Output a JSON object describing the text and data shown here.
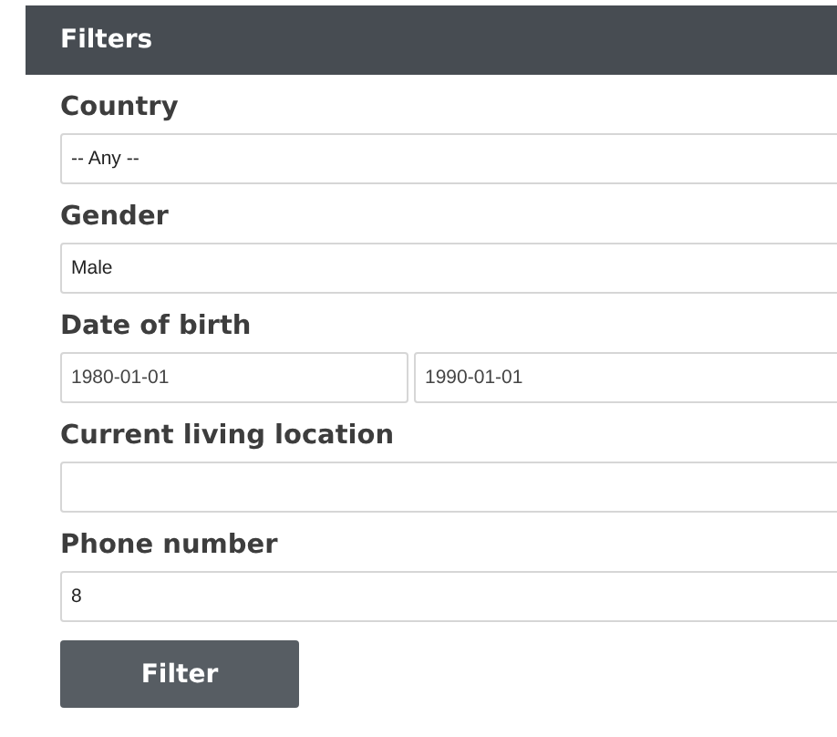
{
  "panel": {
    "title": "Filters"
  },
  "fields": [
    {
      "kind": "select",
      "label": "Country",
      "values": [
        "-- Any --"
      ]
    },
    {
      "kind": "select",
      "label": "Gender",
      "values": [
        "Male"
      ]
    },
    {
      "kind": "range",
      "label": "Date of birth",
      "values": [
        "1980-01-01",
        "1990-01-01"
      ]
    },
    {
      "kind": "text",
      "label": "Current living location"
    },
    {
      "kind": "text",
      "label": "Phone number",
      "values": [
        "8"
      ]
    }
  ],
  "submit": {
    "label": "Filter"
  }
}
